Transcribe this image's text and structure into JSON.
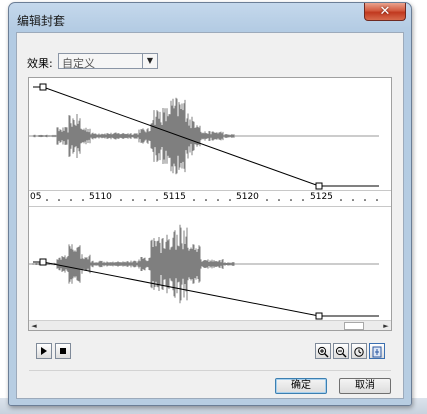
{
  "dialog": {
    "title": "编辑封套",
    "close_glyph": "✕"
  },
  "effect": {
    "label": "效果:",
    "selected": "自定义",
    "dropdown_arrow": "▼"
  },
  "ruler": {
    "labels": [
      "05",
      "5110",
      "5115",
      "5120",
      "5125"
    ]
  },
  "icons": {
    "zoom_in": "zoom-in-icon",
    "zoom_out": "zoom-out-icon",
    "zoom_reset": "zoom-reset-icon",
    "fit": "fit-icon"
  },
  "scrollbar": {
    "left_arrow": "◄",
    "right_arrow": "►"
  },
  "buttons": {
    "ok": "确定",
    "cancel": "取消"
  },
  "colors": {
    "close_button": "#c8452b",
    "waveform": "#7f7f7f",
    "envelope": "#000000"
  }
}
